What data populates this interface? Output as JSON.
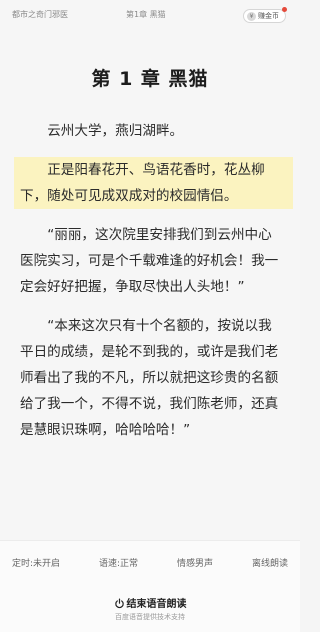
{
  "header": {
    "book_title": "都市之奇门邪医",
    "chapter_title": "第1章 黑猫",
    "coin_icon": "yen-coin-icon",
    "coin_symbol": "¥",
    "earn_label": "赚金币"
  },
  "chapter": {
    "heading": "第 1 章 黑猫"
  },
  "paragraphs": [
    "云州大学，燕归湖畔。",
    "正是阳春花开、鸟语花香时，花丛柳下，随处可见成双成对的校园情侣。",
    "“丽丽，这次院里安排我们到云州中心医院实习，可是个千载难逢的好机会！我一定会好好把握，争取尽快出人头地！”",
    "“本来这次只有十个名额的，按说以我平日的成绩，是轮不到我的，或许是我们老师看出了我的不凡，所以就把这珍贵的名额给了我一个，不得不说，我们陈老师，还真是慧眼识珠啊，哈哈哈哈！”"
  ],
  "highlight": {
    "paragraph_index": 1,
    "color": "#fbf3c0"
  },
  "tts_panel": {
    "timer": "定时:未开启",
    "speed": "语速:正常",
    "voice": "情感男声",
    "offline": "离线朗读",
    "stop_label": "结束语音朗读",
    "stop_icon": "power-icon",
    "provider": "百度语音提供技术支持"
  },
  "colors": {
    "notify_dot": "#e5493a",
    "background": "#f6f6f6"
  }
}
